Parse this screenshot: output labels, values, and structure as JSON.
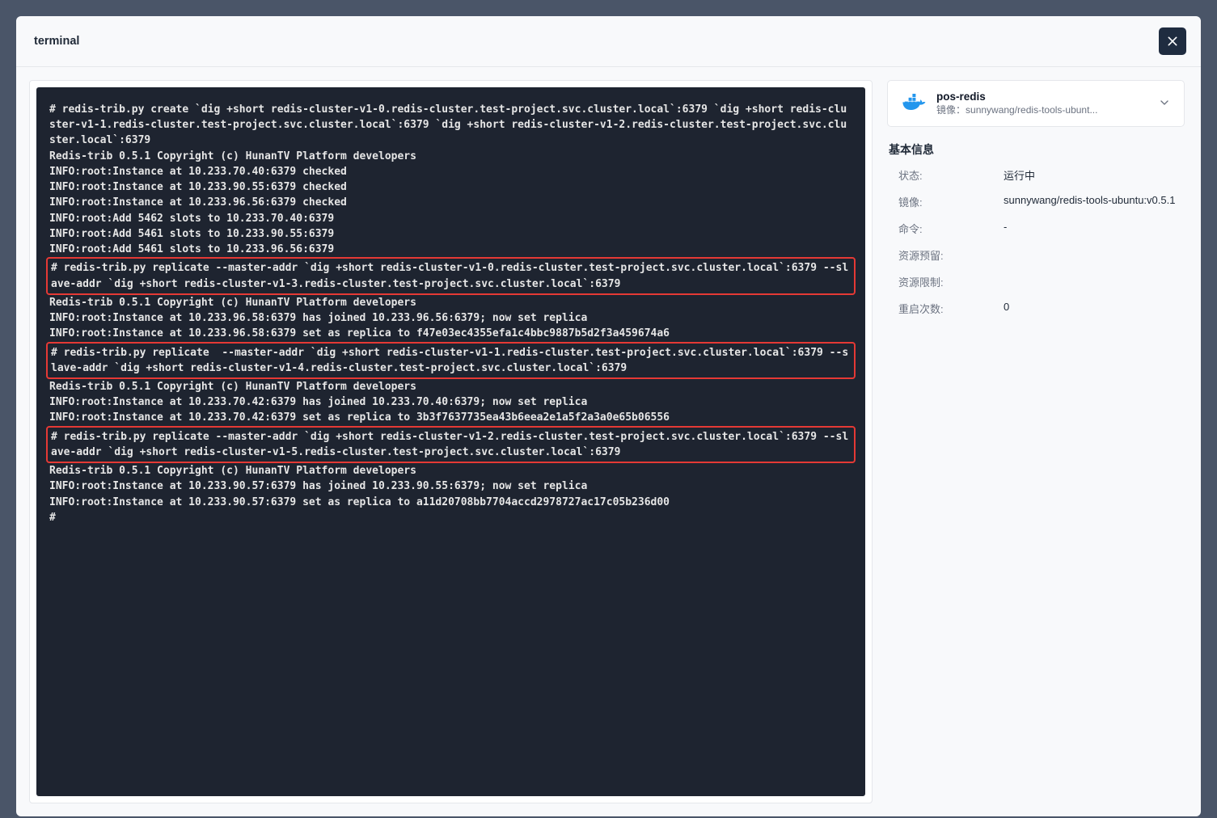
{
  "header": {
    "title": "terminal"
  },
  "terminal": {
    "block1": "# redis-trib.py create `dig +short redis-cluster-v1-0.redis-cluster.test-project.svc.cluster.local`:6379 `dig +short redis-cluster-v1-1.redis-cluster.test-project.svc.cluster.local`:6379 `dig +short redis-cluster-v1-2.redis-cluster.test-project.svc.cluster.local`:6379\nRedis-trib 0.5.1 Copyright (c) HunanTV Platform developers\nINFO:root:Instance at 10.233.70.40:6379 checked\nINFO:root:Instance at 10.233.90.55:6379 checked\nINFO:root:Instance at 10.233.96.56:6379 checked\nINFO:root:Add 5462 slots to 10.233.70.40:6379\nINFO:root:Add 5461 slots to 10.233.90.55:6379\nINFO:root:Add 5461 slots to 10.233.96.56:6379",
    "red1": "# redis-trib.py replicate --master-addr `dig +short redis-cluster-v1-0.redis-cluster.test-project.svc.cluster.local`:6379 --slave-addr `dig +short redis-cluster-v1-3.redis-cluster.test-project.svc.cluster.local`:6379",
    "block2": "Redis-trib 0.5.1 Copyright (c) HunanTV Platform developers\nINFO:root:Instance at 10.233.96.58:6379 has joined 10.233.96.56:6379; now set replica\nINFO:root:Instance at 10.233.96.58:6379 set as replica to f47e03ec4355efa1c4bbc9887b5d2f3a459674a6",
    "red2": "# redis-trib.py replicate  --master-addr `dig +short redis-cluster-v1-1.redis-cluster.test-project.svc.cluster.local`:6379 --slave-addr `dig +short redis-cluster-v1-4.redis-cluster.test-project.svc.cluster.local`:6379",
    "block3": "Redis-trib 0.5.1 Copyright (c) HunanTV Platform developers\nINFO:root:Instance at 10.233.70.42:6379 has joined 10.233.70.40:6379; now set replica\nINFO:root:Instance at 10.233.70.42:6379 set as replica to 3b3f7637735ea43b6eea2e1a5f2a3a0e65b06556",
    "red3": "# redis-trib.py replicate --master-addr `dig +short redis-cluster-v1-2.redis-cluster.test-project.svc.cluster.local`:6379 --slave-addr `dig +short redis-cluster-v1-5.redis-cluster.test-project.svc.cluster.local`:6379",
    "block4": "Redis-trib 0.5.1 Copyright (c) HunanTV Platform developers\nINFO:root:Instance at 10.233.90.57:6379 has joined 10.233.90.55:6379; now set replica\nINFO:root:Instance at 10.233.90.57:6379 set as replica to a11d20708bb7704accd2978727ac17c05b236d00\n#"
  },
  "sidebar": {
    "container": {
      "name": "pos-redis",
      "image_label": "镜像：",
      "image_short": "sunnywang/redis-tools-ubunt..."
    },
    "section_title": "基本信息",
    "rows": [
      {
        "label": "状态:",
        "value": "运行中"
      },
      {
        "label": "镜像:",
        "value": "sunnywang/redis-tools-ubuntu:v0.5.1"
      },
      {
        "label": "命令:",
        "value": "-"
      },
      {
        "label": "资源预留:",
        "value": ""
      },
      {
        "label": "资源限制:",
        "value": ""
      },
      {
        "label": "重启次数:",
        "value": "0"
      }
    ]
  }
}
